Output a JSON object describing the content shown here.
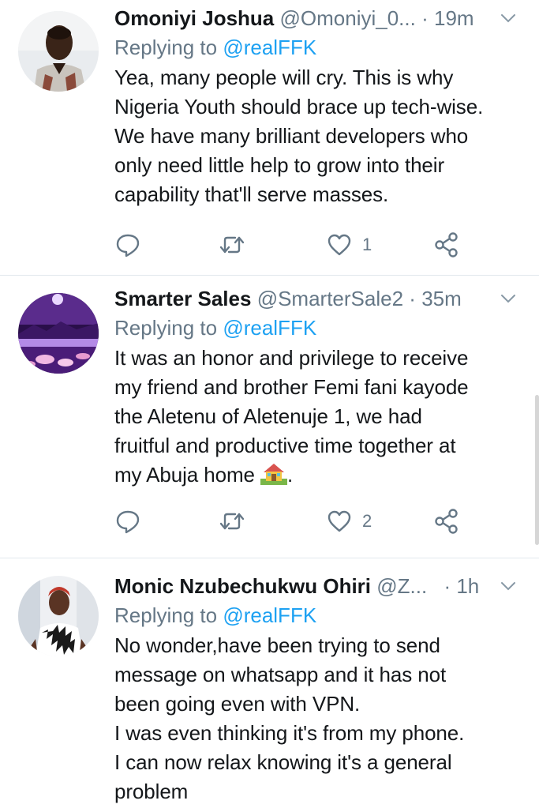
{
  "tweets": [
    {
      "name": "Omoniyi Joshua",
      "handle": "@Omoniyi_0...",
      "time": "19m",
      "replying_prefix": "Replying to",
      "replying_to": "@realFFK",
      "text": "Yea, many people will cry. This is why\nNigeria Youth should brace up tech-wise.\nWe have many brilliant developers who\nonly need little help to grow into their\ncapability that'll serve masses.",
      "likes": "1"
    },
    {
      "name": "Smarter Sales",
      "handle": "@SmarterSale2",
      "time": "35m",
      "replying_prefix": "Replying to",
      "replying_to": "@realFFK",
      "text": "It was an honor and privilege to receive\nmy friend and brother Femi fani kayode\nthe Aletenu of Aletenuje 1, we had\nfruitful and productive time together at\nmy Abuja home",
      "text_suffix": ".",
      "likes": "2"
    },
    {
      "name": "Monic Nzubechukwu Ohiri",
      "handle": "@Z...",
      "time": "1h",
      "replying_prefix": "Replying to",
      "replying_to": "@realFFK",
      "text": "No wonder,have been trying to send\nmessage on whatsapp and it has not\nbeen going even with VPN.\nI was even thinking it's from my phone.\nI can now relax knowing it's a general\nproblem"
    }
  ],
  "separator": "·",
  "icons": {
    "reply": "reply-icon",
    "retweet": "retweet-icon",
    "like": "heart-icon",
    "share": "share-icon",
    "more": "chevron-down-icon",
    "emoji": "house-emoji"
  },
  "colors": {
    "text": "#14171a",
    "secondary": "#657786",
    "link": "#1da1f2",
    "divider": "#e1e8ed"
  }
}
